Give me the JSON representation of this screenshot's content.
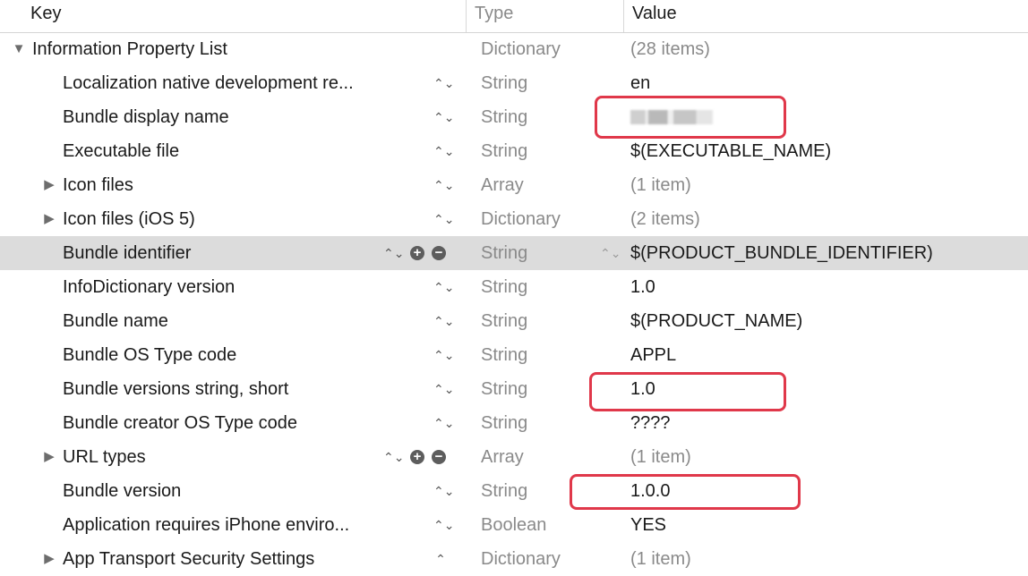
{
  "columns": {
    "key": "Key",
    "type": "Type",
    "value": "Value"
  },
  "glyphs": {
    "expanded": "▼",
    "collapsed": "▶",
    "stepper": "⌃⌄",
    "stepper_up": "⌃",
    "add": "+",
    "remove": "−"
  },
  "highlight_color": "#e0384a",
  "rows": [
    {
      "key": "Information Property List",
      "type": "Dictionary",
      "value": "(28 items)",
      "level": 0,
      "disclosure": "expanded"
    },
    {
      "key": "Localization native development re...",
      "type": "String",
      "value": "en",
      "level": 1
    },
    {
      "key": "Bundle display name",
      "type": "String",
      "value": "",
      "level": 1,
      "value_obscured": true,
      "highlighted": true
    },
    {
      "key": "Executable file",
      "type": "String",
      "value": "$(EXECUTABLE_NAME)",
      "level": 1
    },
    {
      "key": "Icon files",
      "type": "Array",
      "value": "(1 item)",
      "level": 1,
      "disclosure": "collapsed"
    },
    {
      "key": "Icon files (iOS 5)",
      "type": "Dictionary",
      "value": "(2 items)",
      "level": 1,
      "disclosure": "collapsed"
    },
    {
      "key": "Bundle identifier",
      "type": "String",
      "value": "$(PRODUCT_BUNDLE_IDENTIFIER)",
      "level": 1,
      "selected": true
    },
    {
      "key": "InfoDictionary version",
      "type": "String",
      "value": "1.0",
      "level": 1
    },
    {
      "key": "Bundle name",
      "type": "String",
      "value": "$(PRODUCT_NAME)",
      "level": 1
    },
    {
      "key": "Bundle OS Type code",
      "type": "String",
      "value": "APPL",
      "level": 1
    },
    {
      "key": "Bundle versions string, short",
      "type": "String",
      "value": "1.0",
      "level": 1,
      "highlighted": true
    },
    {
      "key": "Bundle creator OS Type code",
      "type": "String",
      "value": "????",
      "level": 1
    },
    {
      "key": "URL types",
      "type": "Array",
      "value": "(1 item)",
      "level": 1,
      "disclosure": "collapsed"
    },
    {
      "key": "Bundle version",
      "type": "String",
      "value": "1.0.0",
      "level": 1,
      "highlighted": true
    },
    {
      "key": "Application requires iPhone enviro...",
      "type": "Boolean",
      "value": "YES",
      "level": 1
    },
    {
      "key": "App Transport Security Settings",
      "type": "Dictionary",
      "value": "(1 item)",
      "level": 1,
      "disclosure": "collapsed"
    }
  ]
}
